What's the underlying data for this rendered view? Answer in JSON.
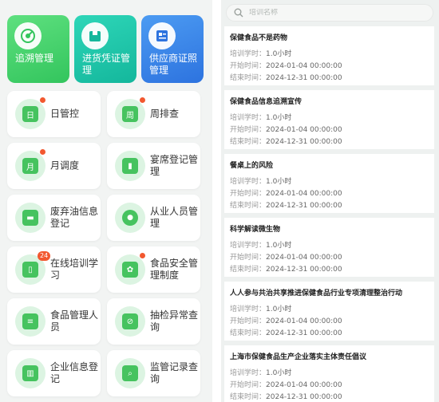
{
  "top_cards": [
    {
      "label": "追溯管理",
      "icon": "target-icon"
    },
    {
      "label": "进货凭证管理",
      "icon": "box-icon"
    },
    {
      "label": "供应商证照管理",
      "icon": "id-card-icon"
    }
  ],
  "tiles": [
    {
      "label": "日管控",
      "icon": "calendar-day-icon",
      "glyph": "日",
      "dot": true
    },
    {
      "label": "周排查",
      "icon": "calendar-week-icon",
      "glyph": "周",
      "dot": true
    },
    {
      "label": "月调度",
      "icon": "calendar-month-icon",
      "glyph": "月",
      "dot": true
    },
    {
      "label": "宴席登记管理",
      "icon": "banquet-icon",
      "glyph": "▮",
      "dot": false
    },
    {
      "label": "废弃油信息登记",
      "icon": "trash-icon",
      "glyph": "▬",
      "dot": false
    },
    {
      "label": "从业人员管理",
      "icon": "staff-icon",
      "glyph": "●",
      "dot": false
    },
    {
      "label": "在线培训学习",
      "icon": "book-icon",
      "glyph": "▯",
      "badge": "24"
    },
    {
      "label": "食品安全管理制度",
      "icon": "policy-icon",
      "glyph": "✿",
      "dot": true
    },
    {
      "label": "食品管理人员",
      "icon": "manager-icon",
      "glyph": "≡",
      "dot": false
    },
    {
      "label": "抽检异常查询",
      "icon": "inspection-icon",
      "glyph": "⊘",
      "dot": false
    },
    {
      "label": "企业信息登记",
      "icon": "company-icon",
      "glyph": "▥",
      "dot": false
    },
    {
      "label": "监管记录查询",
      "icon": "record-search-icon",
      "glyph": "⌕",
      "dot": false
    }
  ],
  "search": {
    "placeholder": "培训名称"
  },
  "field_labels": {
    "hours": "培训学时：",
    "start": "开始时间：",
    "end": "结束时间："
  },
  "trainings": [
    {
      "title": "保健食品不是药物",
      "hours": "1.0小时",
      "start": "2024-01-04 00:00:00",
      "end": "2024-12-31 00:00:00"
    },
    {
      "title": "保健食品信息追溯宣传",
      "hours": "1.0小时",
      "start": "2024-01-04 00:00:00",
      "end": "2024-12-31 00:00:00"
    },
    {
      "title": "餐桌上的风险",
      "hours": "1.0小时",
      "start": "2024-01-04 00:00:00",
      "end": "2024-12-31 00:00:00"
    },
    {
      "title": "科学解读微生物",
      "hours": "1.0小时",
      "start": "2024-01-04 00:00:00",
      "end": "2024-12-31 00:00:00"
    },
    {
      "title": "人人参与共治共享推进保健食品行业专项清理整治行动",
      "hours": "1.0小时",
      "start": "2024-01-04 00:00:00",
      "end": "2024-12-31 00:00:00"
    },
    {
      "title": "上海市保健食品生产企业落实主体责任倡议",
      "hours": "1.0小时",
      "start": "2024-01-04 00:00:00",
      "end": "2024-12-31 00:00:00"
    }
  ],
  "colors": {
    "primary_green": "#46c35f",
    "alert_red": "#f2582f",
    "blue": "#2d73df"
  }
}
